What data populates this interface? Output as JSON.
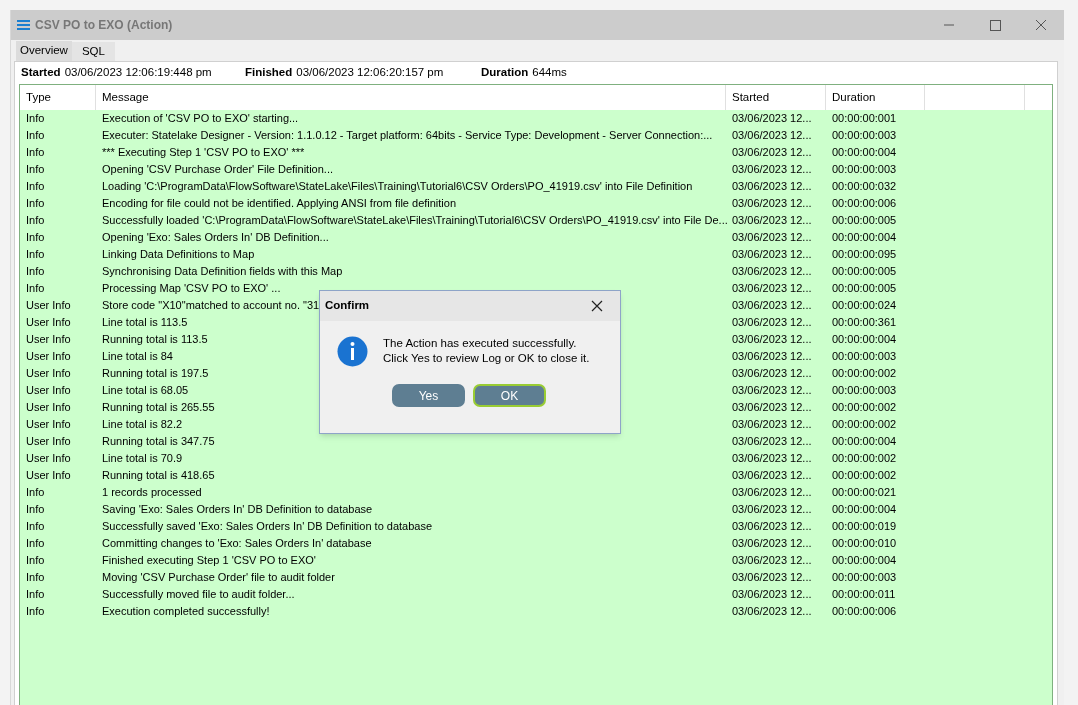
{
  "window": {
    "title": "CSV PO to EXO (Action)"
  },
  "tabs": [
    {
      "label": "Overview",
      "selected": true
    },
    {
      "label": "SQL",
      "selected": false
    }
  ],
  "summary": [
    {
      "label": "Started",
      "value": "03/06/2023 12:06:19:448 pm"
    },
    {
      "label": "Finished",
      "value": "03/06/2023 12:06:20:157 pm"
    },
    {
      "label": "Duration",
      "value": "644ms"
    }
  ],
  "table": {
    "columns": [
      "Type",
      "Message",
      "Started",
      "Duration"
    ],
    "rows": [
      [
        "Info",
        "Execution of 'CSV PO to EXO' starting...",
        "03/06/2023 12...",
        "00:00:00:001"
      ],
      [
        "Info",
        "Executer: Statelake Designer - Version: 1.1.0.12 - Target platform:  64bits - Service Type: Development - Server Connection:...",
        "03/06/2023 12...",
        "00:00:00:003"
      ],
      [
        "Info",
        "*** Executing Step 1 'CSV PO to EXO' ***",
        "03/06/2023 12...",
        "00:00:00:004"
      ],
      [
        "Info",
        "Opening 'CSV Purchase Order' File Definition...",
        "03/06/2023 12...",
        "00:00:00:003"
      ],
      [
        "Info",
        "Loading 'C:\\ProgramData\\FlowSoftware\\StateLake\\Files\\Training\\Tutorial6\\CSV Orders\\PO_41919.csv' into File Definition",
        "03/06/2023 12...",
        "00:00:00:032"
      ],
      [
        "Info",
        "Encoding for file could not be identified.  Applying ANSI from file definition",
        "03/06/2023 12...",
        "00:00:00:006"
      ],
      [
        "Info",
        "Successfully loaded 'C:\\ProgramData\\FlowSoftware\\StateLake\\Files\\Training\\Tutorial6\\CSV Orders\\PO_41919.csv' into File De...",
        "03/06/2023 12...",
        "00:00:00:005"
      ],
      [
        "Info",
        "Opening 'Exo: Sales Orders In' DB Definition...",
        "03/06/2023 12...",
        "00:00:00:004"
      ],
      [
        "Info",
        "Linking Data Definitions to Map",
        "03/06/2023 12...",
        "00:00:00:095"
      ],
      [
        "Info",
        "Synchronising Data Definition fields with this Map",
        "03/06/2023 12...",
        "00:00:00:005"
      ],
      [
        "Info",
        "Processing Map 'CSV PO to EXO' ...",
        "03/06/2023 12...",
        "00:00:00:005"
      ],
      [
        "User Info",
        "Store code \"X10\"matched to account no. \"31",
        "03/06/2023 12...",
        "00:00:00:024"
      ],
      [
        "User Info",
        "Line total is 113.5",
        "03/06/2023 12...",
        "00:00:00:361"
      ],
      [
        "User Info",
        "Running total is 113.5",
        "03/06/2023 12...",
        "00:00:00:004"
      ],
      [
        "User Info",
        "Line total is 84",
        "03/06/2023 12...",
        "00:00:00:003"
      ],
      [
        "User Info",
        "Running total is 197.5",
        "03/06/2023 12...",
        "00:00:00:002"
      ],
      [
        "User Info",
        "Line total is 68.05",
        "03/06/2023 12...",
        "00:00:00:003"
      ],
      [
        "User Info",
        "Running total is 265.55",
        "03/06/2023 12...",
        "00:00:00:002"
      ],
      [
        "User Info",
        "Line total is 82.2",
        "03/06/2023 12...",
        "00:00:00:002"
      ],
      [
        "User Info",
        "Running total is 347.75",
        "03/06/2023 12...",
        "00:00:00:004"
      ],
      [
        "User Info",
        "Line total is 70.9",
        "03/06/2023 12...",
        "00:00:00:002"
      ],
      [
        "User Info",
        "Running total is 418.65",
        "03/06/2023 12...",
        "00:00:00:002"
      ],
      [
        "Info",
        "1 records processed",
        "03/06/2023 12...",
        "00:00:00:021"
      ],
      [
        "Info",
        "Saving 'Exo: Sales Orders In' DB Definition to database",
        "03/06/2023 12...",
        "00:00:00:004"
      ],
      [
        "Info",
        "Successfully saved 'Exo: Sales Orders In' DB Definition to database",
        "03/06/2023 12...",
        "00:00:00:019"
      ],
      [
        "Info",
        "Committing changes to 'Exo: Sales Orders In' database",
        "03/06/2023 12...",
        "00:00:00:010"
      ],
      [
        "Info",
        "Finished executing Step 1 'CSV PO to EXO'",
        "03/06/2023 12...",
        "00:00:00:004"
      ],
      [
        "Info",
        "Moving 'CSV Purchase Order' file to audit folder",
        "03/06/2023 12...",
        "00:00:00:003"
      ],
      [
        "Info",
        "Successfully moved file to audit folder...",
        "03/06/2023 12...",
        "00:00:00:011"
      ],
      [
        "Info",
        "Execution completed successfully!",
        "03/06/2023 12...",
        "00:00:00:006"
      ]
    ]
  },
  "dialog": {
    "title": "Confirm",
    "message_lines": [
      "The Action has executed successfully.",
      "Click Yes to review Log or OK to close it."
    ],
    "buttons": [
      {
        "label": "Yes",
        "selected": false
      },
      {
        "label": "OK",
        "selected": true
      }
    ]
  }
}
